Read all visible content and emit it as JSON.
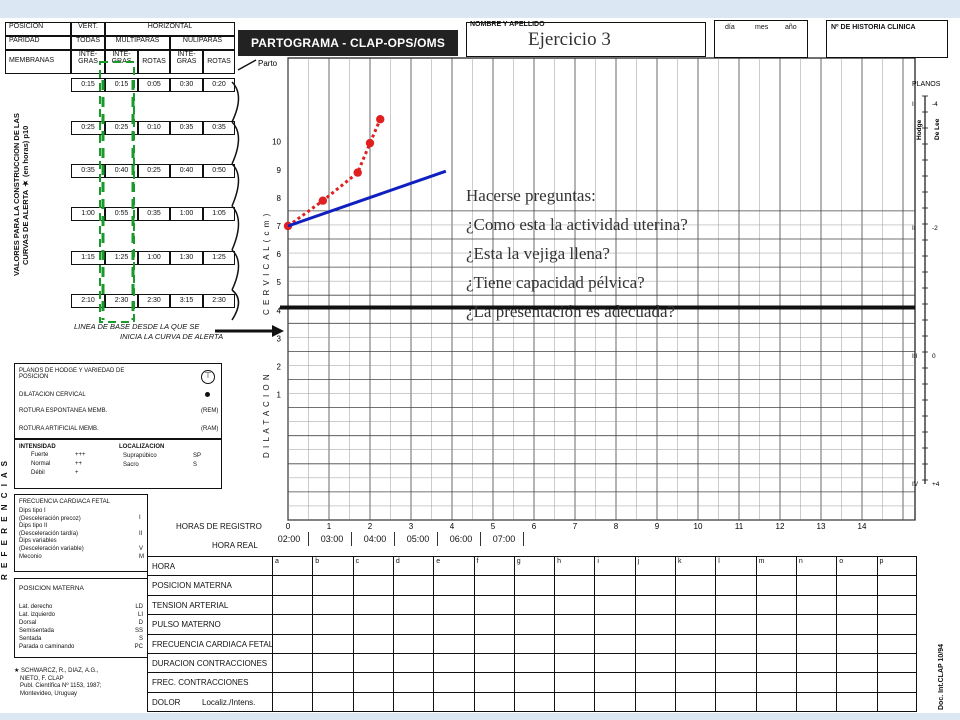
{
  "left_table": {
    "headers": {
      "posicion": "POSICION",
      "paridad": "PARIDAD",
      "membranas": "MEMBRANAS",
      "vert": "VERT.",
      "horizontal": "HORIZONTAL",
      "todas": "TODAS",
      "multiparas": "MULTIPARAS",
      "nuliparas": "NULIPARAS",
      "integras_a": "INTE-\nGRAS",
      "integras_b": "INTE-\nGRAS",
      "rotas_a": "ROTAS",
      "integras_c": "INTE-\nGRAS",
      "rotas_b": "ROTAS"
    },
    "rows": [
      [
        "0:15",
        "0:15",
        "0:05",
        "0:30",
        "0:20"
      ],
      [
        "0:25",
        "0:25",
        "0:10",
        "0:35",
        "0:35"
      ],
      [
        "0:35",
        "0:40",
        "0:25",
        "0:40",
        "0:50"
      ],
      [
        "1:00",
        "0:55",
        "0:35",
        "1:00",
        "1:05"
      ],
      [
        "1:15",
        "1:25",
        "1:00",
        "1:30",
        "1:25"
      ],
      [
        "2:10",
        "2:30",
        "2:30",
        "3:15",
        "2:30"
      ]
    ],
    "side_label": "VALORES PARA LA CONSTRUCCION DE LAS CURVAS DE ALERTA ★ (en horas) p10",
    "baseline_note_1": "LINEA DE BASE DESDE LA QUE SE",
    "baseline_note_2": "INICIA LA CURVA DE ALERTA"
  },
  "header": {
    "title": "PARTOGRAMA  - CLAP-OPS/OMS",
    "nombre": "NOMBRE Y APELLIDO",
    "dia": "día",
    "mes": "mes",
    "anio": "año",
    "historia": "Nº DE HISTORIA CLINICA",
    "exercise": "Ejercicio 3"
  },
  "chart_data": {
    "type": "line",
    "title": "",
    "xlabel": "HORAS DE REGISTRO",
    "ylabel": "D I L A T A C I O N    C E R V I C A L   ( c m )",
    "xlim": [
      0,
      15
    ],
    "ylim": [
      0,
      10.8
    ],
    "x_ticks": [
      "0",
      "1",
      "2",
      "3",
      "4",
      "5",
      "6",
      "7",
      "8",
      "9",
      "10",
      "11",
      "12",
      "13",
      "14"
    ],
    "y_ticks": [
      "1",
      "2",
      "3",
      "4",
      "5",
      "6",
      "7",
      "8",
      "9",
      "10"
    ],
    "top_label": "Parto",
    "series": [
      {
        "name": "",
        "style": "dotted",
        "color": "#e02020",
        "x": [
          0,
          0.85,
          1.7,
          2.0,
          2.25
        ],
        "y": [
          7,
          7.9,
          8.9,
          9.95,
          10.8
        ]
      },
      {
        "name": "",
        "style": "solid",
        "color": "#1020c0",
        "x": [
          0,
          3.85
        ],
        "y": [
          7,
          8.95
        ]
      }
    ],
    "hora_real": [
      "02:00",
      "03:00",
      "04:00",
      "05:00",
      "06:00",
      "07:00"
    ],
    "hora_real_label": "HORA REAL",
    "planos_title": "PLANOS",
    "hodge_label": "Hodge",
    "delee_label": "De Lee",
    "planos": [
      {
        "hodge": "I",
        "delee": "-4"
      },
      {
        "hodge": "II",
        "delee": "-2"
      },
      {
        "hodge": "III",
        "delee": "0"
      },
      {
        "hodge": "IV",
        "delee": "+4"
      }
    ]
  },
  "questions": [
    "Hacerse preguntas:",
    "¿Como esta la actividad uterina?",
    "¿Esta la vejiga llena?",
    "¿Tiene capacidad pélvica?",
    "¿La presentación es adecuada?"
  ],
  "bottom_table": {
    "rows": [
      "HORA",
      "POSICION MATERNA",
      "TENSION ARTERIAL",
      "PULSO MATERNO",
      "FRECUENCIA CARDIACA FETAL",
      "DURACION CONTRACCIONES",
      "FREC. CONTRACCIONES",
      "DOLOR"
    ],
    "dolor_sub": "Localiz./Intens.",
    "letters": [
      "a",
      "b",
      "c",
      "d",
      "e",
      "f",
      "g",
      "h",
      "i",
      "j",
      "k",
      "l",
      "m",
      "n",
      "o",
      "p"
    ]
  },
  "references": {
    "side_title": "R E F E R E N C I A S",
    "planos": "PLANOS DE HODGE Y VARIEDAD DE POSICION",
    "dilatacion": "DILATACION CERVICAL",
    "rem_label": "ROTURA ESPONTANEA MEMB.",
    "rem_code": "(REM)",
    "ram_label": "ROTURA ARTIFICIAL MEMB.",
    "ram_code": "(RAM)",
    "intensidad": "INTENSIDAD",
    "fuerte": "Fuerte",
    "fuerte_c": "+++",
    "normal": "Normal",
    "normal_c": "++",
    "debil": "Débil",
    "debil_c": "+",
    "localizacion": "LOCALIZACION",
    "suprapubico": "Suprapúbico",
    "suprapubico_c": "SP",
    "sacro": "Sacro",
    "sacro_c": "S",
    "fcf_title": "FRECUENCIA CARDIACA FETAL",
    "fcf_items": [
      "Dips tipo I",
      "(Desceleración precoz)",
      "Dips tipo II",
      "(Desceleración tardía)",
      "Dips variables",
      "(Desceleración variable)",
      "Meconio"
    ],
    "fcf_codes": [
      "I",
      "II",
      "V",
      "M"
    ],
    "pm_title": "POSICION MATERNA",
    "pm_items": [
      "Lat. derecho",
      "Lat. izquierdo",
      "Dorsal",
      "Semisentada",
      "Sentada",
      "Parada o caminando"
    ],
    "pm_codes": [
      "LD",
      "LI",
      "D",
      "SS",
      "S",
      "PC"
    ],
    "citation": [
      "SCHWARCZ, R., DIAZ, A.G.,",
      "NIETO, F. CLAP",
      "Publ. Científica Nº 1153, 1987;",
      "Montevideo, Uruguay"
    ],
    "doc_id": "Doc. Int.CLAP 10/94"
  }
}
